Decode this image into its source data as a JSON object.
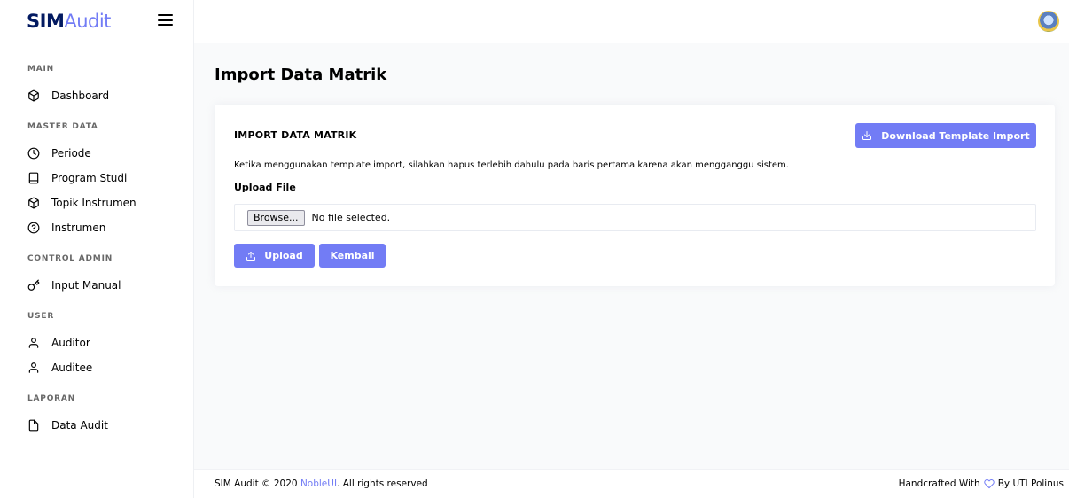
{
  "brand": {
    "bold": "SIM",
    "light": "Audit"
  },
  "sidebar": {
    "sections": [
      {
        "label": "MAIN",
        "items": [
          {
            "label": "Dashboard",
            "icon": "box-icon"
          }
        ]
      },
      {
        "label": "MASTER DATA",
        "items": [
          {
            "label": "Periode",
            "icon": "clock-icon"
          },
          {
            "label": "Program Studi",
            "icon": "tablet-icon"
          },
          {
            "label": "Topik Instrumen",
            "icon": "box-icon"
          },
          {
            "label": "Instrumen",
            "icon": "help-circle-icon"
          }
        ]
      },
      {
        "label": "CONTROL ADMIN",
        "items": [
          {
            "label": "Input Manual",
            "icon": "key-icon"
          }
        ]
      },
      {
        "label": "USER",
        "items": [
          {
            "label": "Auditor",
            "icon": "user-icon"
          },
          {
            "label": "Auditee",
            "icon": "user-icon"
          }
        ]
      },
      {
        "label": "LAPORAN",
        "items": [
          {
            "label": "Data Audit",
            "icon": "file-icon"
          }
        ]
      }
    ]
  },
  "page": {
    "title": "Import Data Matrik",
    "card_title": "IMPORT DATA MATRIK",
    "download_label": "Download Template Import",
    "description": "Ketika menggunakan template import, silahkan hapus terlebih dahulu pada baris pertama karena akan mengganggu sistem.",
    "upload_label": "Upload File",
    "browse_label": "Browse...",
    "file_status": "No file selected.",
    "upload_button": "Upload",
    "back_button": "Kembali"
  },
  "footer": {
    "prefix": "SIM Audit © 2020 ",
    "link": "NobleUI",
    "suffix": ". All rights reserved",
    "right_prefix": "Handcrafted With",
    "right_suffix": "By UTI Polinus"
  },
  "colors": {
    "accent": "#727cf5",
    "brand_dark": "#031a61"
  }
}
